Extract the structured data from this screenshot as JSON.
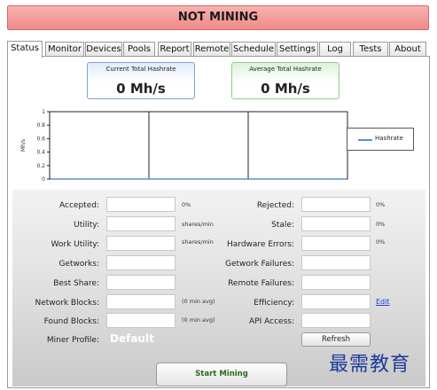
{
  "status_banner": "NOT MINING",
  "tabs": [
    "Status",
    "Monitor",
    "Devices",
    "Pools",
    "Report",
    "Remote",
    "Schedule",
    "Settings",
    "Log",
    "Tests",
    "About"
  ],
  "active_tab": "Status",
  "hashrate": {
    "current": {
      "title": "Current Total Hashrate",
      "value": "0 Mh/s"
    },
    "average": {
      "title": "Average Total Hashrate",
      "value": "0 Mh/s"
    }
  },
  "chart_data": {
    "type": "line",
    "ylabel": "Mh/s",
    "ylim": [
      0,
      1
    ],
    "yticks": [
      "0",
      "0.2",
      "0.4",
      "0.6",
      "0.8",
      "1"
    ],
    "series": [
      {
        "name": "Hashrate",
        "values": [
          0,
          0,
          0,
          0,
          0,
          0
        ]
      }
    ],
    "legend": "right",
    "grid": true
  },
  "stats": {
    "accepted": {
      "label": "Accepted:",
      "value": "",
      "suffix": "0%"
    },
    "utility": {
      "label": "Utility:",
      "value": "",
      "suffix": "shares/min"
    },
    "work_utility": {
      "label": "Work Utility:",
      "value": "",
      "suffix": "shares/min"
    },
    "getworks": {
      "label": "Getworks:",
      "value": ""
    },
    "best_share": {
      "label": "Best Share:",
      "value": ""
    },
    "network_blocks": {
      "label": "Network Blocks:",
      "value": "",
      "suffix": "(0 min avg)"
    },
    "found_blocks": {
      "label": "Found Blocks:",
      "value": "",
      "suffix": "(0 min avg)"
    },
    "rejected": {
      "label": "Rejected:",
      "value": "",
      "suffix": "0%"
    },
    "stale": {
      "label": "Stale:",
      "value": "",
      "suffix": "0%"
    },
    "hardware_errors": {
      "label": "Hardware Errors:",
      "value": "",
      "suffix": "0%"
    },
    "getwork_failures": {
      "label": "Getwork Failures:",
      "value": ""
    },
    "remote_failures": {
      "label": "Remote Failures:",
      "value": ""
    },
    "efficiency": {
      "label": "Efficiency:",
      "value": "",
      "link": "Edit"
    },
    "api_access": {
      "label": "API Access:",
      "value": ""
    }
  },
  "miner_profile": {
    "label": "Miner Profile:",
    "value": "Default"
  },
  "buttons": {
    "refresh": "Refresh",
    "start_mining": "Start Mining"
  },
  "watermark": "最需教育",
  "colors": {
    "banner": "#f08a88",
    "current_box": "#e2ecfb",
    "average_box": "#dbf3d9",
    "link": "#1f3fd0",
    "series": "#5b8fd9"
  }
}
